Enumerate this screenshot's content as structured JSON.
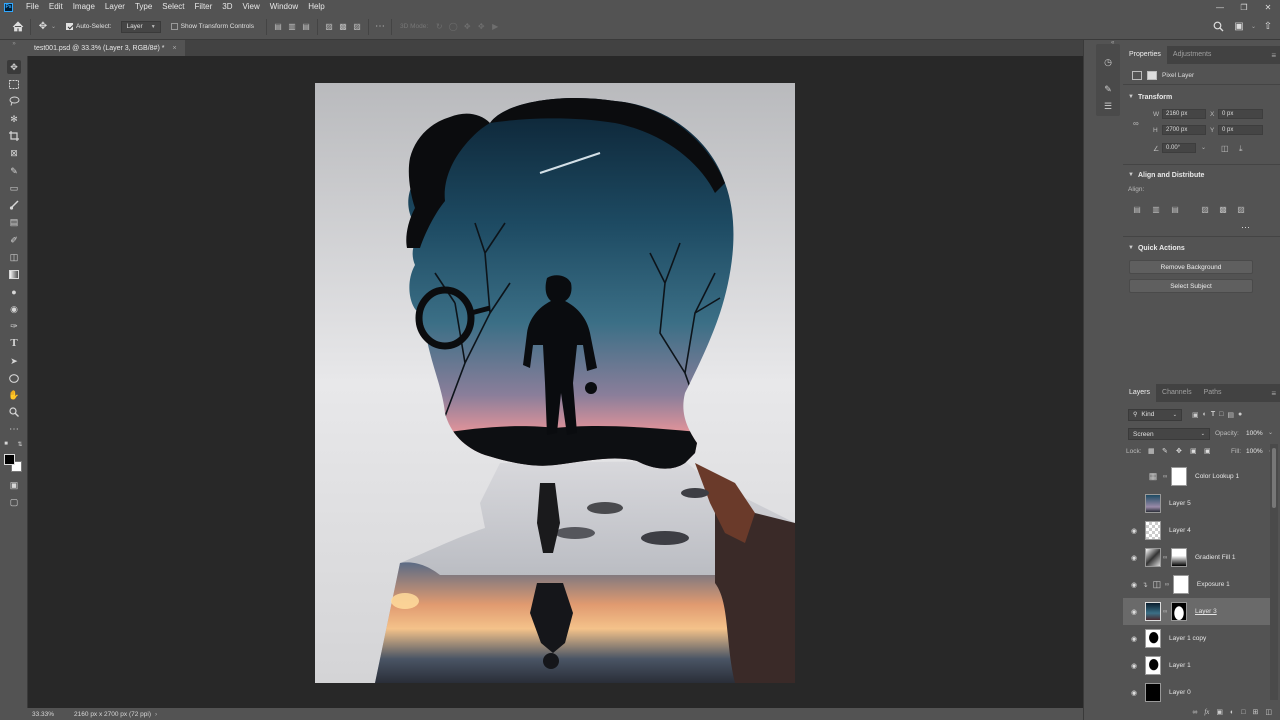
{
  "app": {
    "name": "Ps"
  },
  "menu": [
    "File",
    "Edit",
    "Image",
    "Layer",
    "Type",
    "Select",
    "Filter",
    "3D",
    "View",
    "Window",
    "Help"
  ],
  "options": {
    "auto_select_label": "Auto-Select:",
    "layer_select": "Layer",
    "transform_label": "Show Transform Controls",
    "mode_3d_label": "3D Mode:"
  },
  "document": {
    "tab_title": "test001.psd @ 33.3% (Layer 3, RGB/8#) *",
    "zoom": "33.33%",
    "dimensions": "2160 px x 2700 px (72 ppi)"
  },
  "properties": {
    "tabs": [
      "Properties",
      "Adjustments"
    ],
    "layer_type": "Pixel Layer",
    "transform_title": "Transform",
    "w_label": "W",
    "w_value": "2160 px",
    "h_label": "H",
    "h_value": "2700 px",
    "x_label": "X",
    "x_value": "0 px",
    "y_label": "Y",
    "y_value": "0 px",
    "angle_value": "0.00°",
    "align_title": "Align and Distribute",
    "align_label": "Align:",
    "quick_actions_title": "Quick Actions",
    "remove_bg": "Remove Background",
    "select_subject": "Select Subject"
  },
  "layers_panel": {
    "tabs": [
      "Layers",
      "Channels",
      "Paths"
    ],
    "filter_kind": "Kind",
    "blend_mode": "Screen",
    "opacity_label": "Opacity:",
    "opacity_value": "100%",
    "lock_label": "Lock:",
    "fill_label": "Fill:",
    "fill_value": "100%",
    "layers": [
      {
        "name": "Color Lookup 1",
        "visible": false
      },
      {
        "name": "Layer 5",
        "visible": false
      },
      {
        "name": "Layer 4",
        "visible": true
      },
      {
        "name": "Gradient Fill 1",
        "visible": true
      },
      {
        "name": "Exposure 1",
        "visible": true
      },
      {
        "name": "Layer 3",
        "visible": true,
        "selected": true
      },
      {
        "name": "Layer 1 copy",
        "visible": true
      },
      {
        "name": "Layer 1",
        "visible": true
      },
      {
        "name": "Layer 0",
        "visible": true
      }
    ]
  },
  "colors": {
    "accent": "#31a8ff",
    "panel": "#535353",
    "canvas_bg": "#282828"
  }
}
